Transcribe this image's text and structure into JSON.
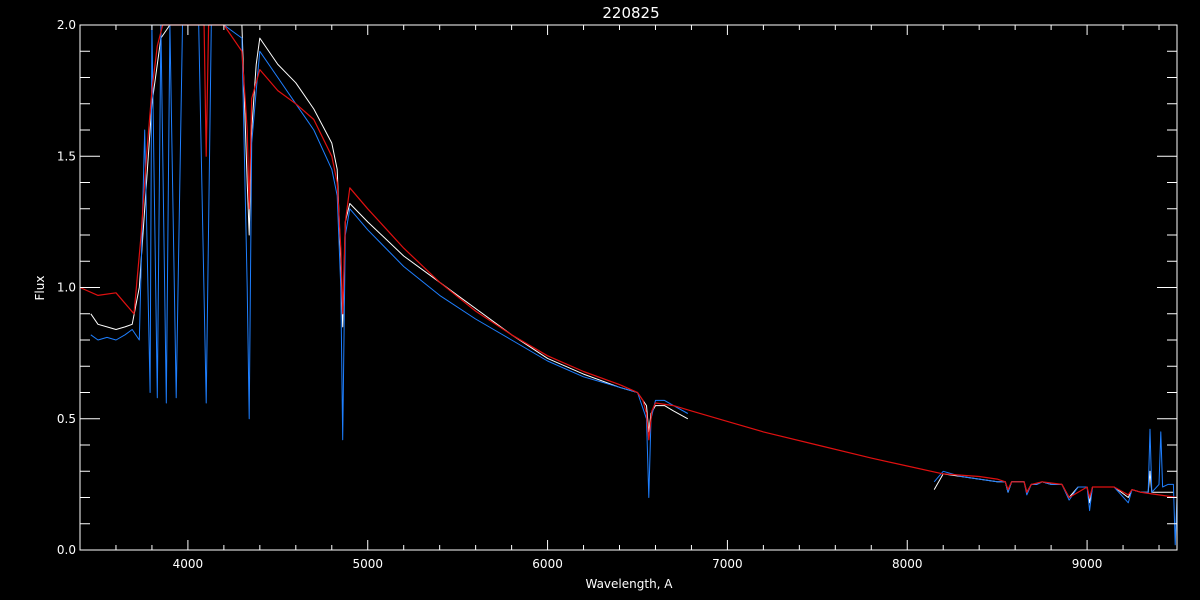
{
  "chart_data": {
    "type": "line",
    "title": "220825",
    "xlabel": "Wavelength, A",
    "ylabel": "Flux",
    "xlim": [
      3400,
      9500
    ],
    "ylim": [
      0.0,
      2.0
    ],
    "x_ticks": [
      4000,
      5000,
      6000,
      7000,
      8000,
      9000
    ],
    "y_ticks": [
      0.0,
      0.5,
      1.0,
      1.5,
      2.0
    ],
    "x_tick_labels": [
      "4000",
      "5000",
      "6000",
      "7000",
      "8000",
      "9000"
    ],
    "y_tick_labels": [
      "0.0",
      "0.5",
      "1.0",
      "1.5",
      "2.0"
    ],
    "grid": false,
    "legend": "none",
    "colors": {
      "background": "#000000",
      "axes": "#ffffff",
      "observed": "#ffffff",
      "observed_alt": "#1e7fff",
      "model": "#e01010"
    },
    "series": [
      {
        "color": "#e01010",
        "x": [
          3400,
          3500,
          3600,
          3650,
          3700,
          3740,
          3770,
          3800,
          3830,
          3860,
          3900,
          3935,
          3955,
          3970,
          3990,
          4060,
          4090,
          4102,
          4115,
          4200,
          4300,
          4330,
          4341,
          4355,
          4400,
          4500,
          4600,
          4700,
          4800,
          4830,
          4850,
          4861,
          4875,
          4900,
          5000,
          5200,
          5400,
          5600,
          5800,
          6000,
          6200,
          6400,
          6500,
          6530,
          6550,
          6563,
          6580,
          6600,
          6700,
          6800,
          7000,
          7200,
          7500,
          7800,
          8000,
          8200,
          8400,
          8500,
          8545,
          8560,
          8580,
          8650,
          8665,
          8690,
          8750,
          8860,
          8900,
          9000,
          9014,
          9030,
          9150,
          9229,
          9250,
          9300,
          9400,
          9500
        ],
        "y": [
          1.0,
          0.97,
          0.98,
          0.94,
          0.9,
          1.2,
          1.5,
          1.75,
          1.92,
          2.0,
          2.0,
          2.0,
          2.0,
          2.0,
          2.0,
          2.0,
          2.0,
          1.5,
          2.0,
          2.0,
          1.9,
          1.6,
          1.3,
          1.72,
          1.83,
          1.75,
          1.7,
          1.64,
          1.5,
          1.4,
          1.15,
          0.9,
          1.25,
          1.38,
          1.3,
          1.15,
          1.02,
          0.91,
          0.82,
          0.74,
          0.68,
          0.63,
          0.6,
          0.57,
          0.52,
          0.42,
          0.53,
          0.56,
          0.55,
          0.53,
          0.49,
          0.45,
          0.4,
          0.35,
          0.32,
          0.29,
          0.28,
          0.27,
          0.26,
          0.23,
          0.26,
          0.26,
          0.22,
          0.25,
          0.26,
          0.25,
          0.2,
          0.24,
          0.2,
          0.24,
          0.24,
          0.21,
          0.23,
          0.22,
          0.21,
          0.2
        ]
      },
      {
        "color": "#ffffff",
        "x": [
          3460,
          3500,
          3550,
          3600,
          3650,
          3690,
          3730,
          3770,
          3800,
          3850,
          3900,
          3970,
          4000,
          4100,
          4200,
          4300,
          4330,
          4341,
          4355,
          4380,
          4400,
          4500,
          4600,
          4700,
          4800,
          4830,
          4850,
          4861,
          4875,
          4900,
          5000,
          5200,
          5400,
          5600,
          5800,
          6000,
          6200,
          6400,
          6500,
          6550,
          6563,
          6575,
          6600,
          6650,
          6700,
          6780
        ],
        "y": [
          0.9,
          0.86,
          0.85,
          0.84,
          0.85,
          0.86,
          1.0,
          1.4,
          1.7,
          1.95,
          2.0,
          2.0,
          2.0,
          2.0,
          2.0,
          2.0,
          1.4,
          1.2,
          1.6,
          1.85,
          1.95,
          1.85,
          1.78,
          1.68,
          1.55,
          1.45,
          1.1,
          0.85,
          1.25,
          1.32,
          1.25,
          1.12,
          1.02,
          0.92,
          0.82,
          0.73,
          0.67,
          0.62,
          0.6,
          0.55,
          0.45,
          0.52,
          0.55,
          0.55,
          0.53,
          0.5
        ]
      },
      {
        "color": "#1e7fff",
        "x": [
          3460,
          3500,
          3550,
          3600,
          3650,
          3690,
          3730,
          3760,
          3790,
          3800,
          3830,
          3850,
          3880,
          3900,
          3935,
          3970,
          4000,
          4060,
          4102,
          4130,
          4200,
          4300,
          4330,
          4341,
          4355,
          4380,
          4400,
          4500,
          4600,
          4700,
          4800,
          4830,
          4850,
          4861,
          4875,
          4900,
          5000,
          5200,
          5400,
          5600,
          5800,
          6000,
          6200,
          6400,
          6500,
          6550,
          6563,
          6575,
          6600,
          6650,
          6700,
          6780
        ],
        "y": [
          0.82,
          0.8,
          0.81,
          0.8,
          0.82,
          0.84,
          0.8,
          1.6,
          0.6,
          2.0,
          0.58,
          2.0,
          0.56,
          2.0,
          0.58,
          2.0,
          2.0,
          2.0,
          0.56,
          2.0,
          2.0,
          1.95,
          1.0,
          0.5,
          1.55,
          1.75,
          1.9,
          1.8,
          1.7,
          1.6,
          1.45,
          1.35,
          1.0,
          0.42,
          1.2,
          1.3,
          1.22,
          1.08,
          0.97,
          0.88,
          0.8,
          0.72,
          0.66,
          0.62,
          0.6,
          0.5,
          0.2,
          0.5,
          0.57,
          0.57,
          0.55,
          0.52
        ]
      },
      {
        "color": "#ffffff",
        "x": [
          8150,
          8200,
          8300,
          8400,
          8500,
          8545,
          8560,
          8580,
          8600,
          8650,
          8665,
          8690,
          8720,
          8750,
          8800,
          8860,
          8900,
          8950,
          9000,
          9014,
          9030,
          9100,
          9150,
          9229,
          9250,
          9300,
          9340,
          9350,
          9360,
          9400,
          9450,
          9480
        ],
        "y": [
          0.23,
          0.29,
          0.28,
          0.27,
          0.26,
          0.26,
          0.22,
          0.26,
          0.26,
          0.26,
          0.22,
          0.25,
          0.25,
          0.26,
          0.25,
          0.25,
          0.2,
          0.24,
          0.24,
          0.18,
          0.24,
          0.24,
          0.24,
          0.2,
          0.23,
          0.22,
          0.22,
          0.3,
          0.22,
          0.22,
          0.22,
          0.22
        ]
      },
      {
        "color": "#1e7fff",
        "x": [
          8150,
          8200,
          8300,
          8400,
          8500,
          8545,
          8560,
          8580,
          8600,
          8650,
          8665,
          8690,
          8720,
          8750,
          8800,
          8860,
          8900,
          8950,
          9000,
          9014,
          9030,
          9100,
          9150,
          9229,
          9250,
          9300,
          9340,
          9350,
          9360,
          9400,
          9410,
          9420,
          9450,
          9480,
          9490,
          9500
        ],
        "y": [
          0.26,
          0.3,
          0.28,
          0.27,
          0.26,
          0.26,
          0.22,
          0.26,
          0.26,
          0.26,
          0.21,
          0.25,
          0.25,
          0.26,
          0.25,
          0.25,
          0.19,
          0.24,
          0.24,
          0.15,
          0.24,
          0.24,
          0.24,
          0.18,
          0.23,
          0.22,
          0.22,
          0.46,
          0.22,
          0.25,
          0.45,
          0.24,
          0.25,
          0.25,
          0.02,
          0.2
        ]
      },
      {
        "color": "#1e7fff",
        "x": [
          3460,
          5000,
          6000,
          6780,
          6781,
          8149,
          8150,
          9500
        ],
        "y": [
          0.0,
          0.0,
          0.0,
          0.0,
          null,
          null,
          0.0,
          0.0
        ]
      }
    ]
  }
}
